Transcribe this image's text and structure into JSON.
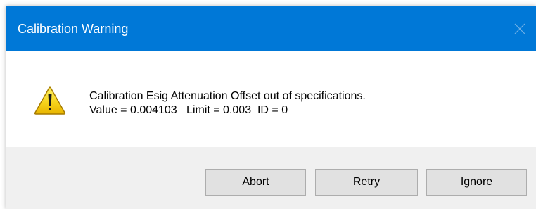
{
  "window": {
    "title": "Calibration Warning",
    "title_bar_color": "#0078d7",
    "close_icon": "close-icon"
  },
  "message": {
    "icon": "warning-icon",
    "line1": "Calibration Esig Attenuation Offset out of specifications.",
    "line2": "Value = 0.004103   Limit = 0.003  ID = 0"
  },
  "buttons": {
    "abort": "Abort",
    "retry": "Retry",
    "ignore": "Ignore"
  }
}
